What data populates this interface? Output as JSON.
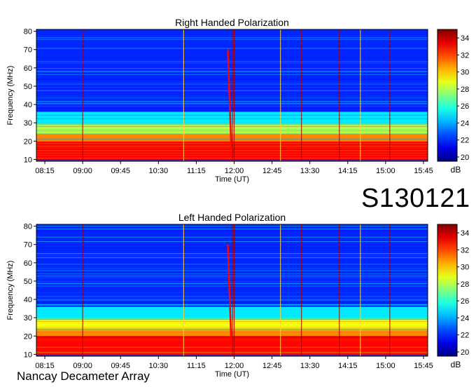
{
  "observation_id": "S130121",
  "instrument": "Nancay Decameter Array",
  "colors": {
    "low": "#00008f",
    "mid": "#40c0ff",
    "high": "#800000"
  },
  "chart_data": [
    {
      "type": "heatmap",
      "title": "Right Handed Polarization",
      "xlabel": "Time (UT)",
      "ylabel": "Frequency (MHz)",
      "x_ticks": [
        "08:15",
        "09:00",
        "09:45",
        "10:30",
        "11:15",
        "12:00",
        "12:45",
        "13:30",
        "14:15",
        "15:00",
        "15:45"
      ],
      "xlim": [
        "08:05",
        "15:50"
      ],
      "y_ticks": [
        10,
        20,
        30,
        40,
        50,
        60,
        70,
        80
      ],
      "ylim": [
        9,
        81
      ],
      "colorbar": {
        "label": "dB",
        "ticks": [
          20,
          22,
          24,
          26,
          28,
          30,
          32,
          34
        ],
        "range": [
          19.5,
          35
        ]
      },
      "bands": [
        {
          "f_low": 10,
          "f_high": 20,
          "level": 33
        },
        {
          "f_low": 20,
          "f_high": 24,
          "level": 31
        },
        {
          "f_low": 24,
          "f_high": 29,
          "level": 28
        },
        {
          "f_low": 29,
          "f_high": 36,
          "level": 25
        },
        {
          "f_low": 36,
          "f_high": 81,
          "level": 22
        }
      ],
      "time_markers": [
        "09:00",
        "11:00",
        "11:58",
        "12:00",
        "12:55",
        "13:20",
        "14:05",
        "14:30",
        "15:05"
      ],
      "burst": {
        "time": "11:55",
        "f_low": 15,
        "f_high": 70
      }
    },
    {
      "type": "heatmap",
      "title": "Left Handed Polarization",
      "xlabel": "Time (UT)",
      "ylabel": "Frequency (MHz)",
      "x_ticks": [
        "08:15",
        "09:00",
        "09:45",
        "10:30",
        "11:15",
        "12:00",
        "12:45",
        "13:30",
        "14:15",
        "15:00",
        "15:45"
      ],
      "xlim": [
        "08:05",
        "15:50"
      ],
      "y_ticks": [
        10,
        20,
        30,
        40,
        50,
        60,
        70,
        80
      ],
      "ylim": [
        9,
        81
      ],
      "colorbar": {
        "label": "dB",
        "ticks": [
          20,
          22,
          24,
          26,
          28,
          30,
          32,
          34
        ],
        "range": [
          19.5,
          35
        ]
      },
      "bands": [
        {
          "f_low": 10,
          "f_high": 20,
          "level": 33
        },
        {
          "f_low": 20,
          "f_high": 24,
          "level": 31
        },
        {
          "f_low": 24,
          "f_high": 29,
          "level": 29
        },
        {
          "f_low": 29,
          "f_high": 36,
          "level": 25
        },
        {
          "f_low": 36,
          "f_high": 81,
          "level": 22
        }
      ],
      "time_markers": [
        "09:00",
        "11:00",
        "11:58",
        "12:00",
        "12:55",
        "13:20",
        "14:05",
        "14:30",
        "15:05"
      ],
      "burst": {
        "time": "11:55",
        "f_low": 15,
        "f_high": 70
      }
    }
  ]
}
